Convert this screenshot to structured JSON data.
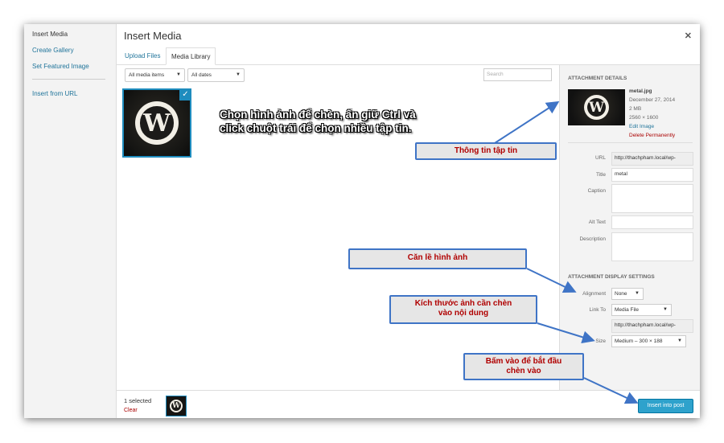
{
  "sidebar": {
    "items": [
      {
        "label": "Insert Media"
      },
      {
        "label": "Create Gallery"
      },
      {
        "label": "Set Featured Image"
      },
      {
        "label": "Insert from URL"
      }
    ]
  },
  "header": {
    "title": "Insert Media",
    "close_icon": "close-icon"
  },
  "tabs": [
    {
      "label": "Upload Files"
    },
    {
      "label": "Media Library"
    }
  ],
  "toolbar": {
    "filter_type": "All media items",
    "filter_date": "All dates",
    "search_placeholder": "Search"
  },
  "grid": {
    "selected_item": "wordpress-logo-icon"
  },
  "details": {
    "heading": "Attachment Details",
    "filename": "metal.jpg",
    "date": "December 27, 2014",
    "size": "2 MB",
    "dimensions": "2560 × 1600",
    "edit_link": "Edit Image",
    "delete_link": "Delete Permanently",
    "url_label": "URL",
    "url_value": "http://thachpham.local/wp-",
    "title_label": "Title",
    "title_value": "metal",
    "caption_label": "Caption",
    "alt_label": "Alt Text",
    "description_label": "Description"
  },
  "display_settings": {
    "heading": "Attachment Display Settings",
    "alignment_label": "Alignment",
    "alignment_value": "None",
    "link_to_label": "Link To",
    "link_to_value": "Media File",
    "link_url": "http://thachpham.local/wp-",
    "size_label": "Size",
    "size_value": "Medium – 300 × 188"
  },
  "footer": {
    "selected_count": "1 selected",
    "clear_label": "Clear",
    "insert_button": "Insert into post"
  },
  "annotations": {
    "overlay_line1": "Chọn hình ảnh để chèn, ấn giữ Ctrl và",
    "overlay_line2": "click chuột trái để chọn nhiều tập tin.",
    "file_info": "Thông tin tập tin",
    "align": "Căn lề hình ảnh",
    "size_line1": "Kích thước ảnh cần chèn",
    "size_line2": "vào nội dung",
    "insert_line1": "Bấm vào để bắt đầu",
    "insert_line2": "chèn vào"
  },
  "colors": {
    "accent": "#1e8cbe",
    "button": "#2ea2cc",
    "callout_text": "#b00000",
    "callout_border": "#3f74c6",
    "delete": "#aa0000"
  }
}
